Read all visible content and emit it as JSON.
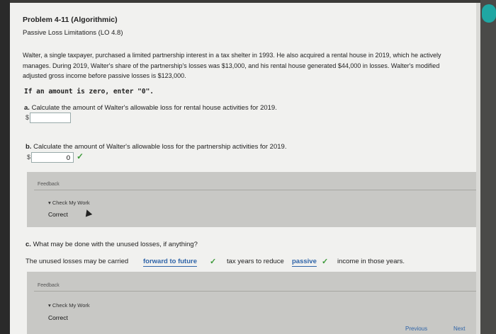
{
  "problem": {
    "title": "Problem 4-11 (Algorithmic)",
    "subtitle": "Passive Loss Limitations (LO 4.8)",
    "text": "Walter, a single taxpayer, purchased a limited partnership interest in a tax shelter in 1993. He also acquired a rental house in 2019, which he actively manages. During 2019, Walter's share of the partnership's losses was $13,000, and his rental house generated $44,000 in losses. Walter's modified adjusted gross income before passive losses is $123,000.",
    "zero_note": "If an amount is zero, enter \"0\"."
  },
  "part_a": {
    "letter": "a.",
    "question": "Calculate the amount of Walter's allowable loss for rental house activities for 2019.",
    "currency": "$",
    "value": ""
  },
  "part_b": {
    "letter": "b.",
    "question": "Calculate the amount of Walter's allowable loss for the partnership activities for 2019.",
    "currency": "$",
    "value": "0",
    "check": "✓"
  },
  "feedback1": {
    "header": "Feedback",
    "check_my_work": "▾ Check My Work",
    "status": "Correct"
  },
  "part_c": {
    "letter": "c.",
    "question": "What may be done with the unused losses, if anything?",
    "sentence_1": "The unused losses may be carried",
    "select_1": "forward to future",
    "check_1": "✓",
    "sentence_2": "tax years to reduce",
    "select_2": "passive",
    "check_2": "✓",
    "sentence_3": "income in those years."
  },
  "feedback2": {
    "header": "Feedback",
    "check_my_work": "▾ Check My Work",
    "status": "Correct"
  },
  "nav": {
    "previous": "Previous",
    "next": "Next"
  },
  "colors": {
    "accent": "#2f64a8",
    "check_green": "#3d9a3a",
    "scroll_teal": "#1fa7a3"
  }
}
